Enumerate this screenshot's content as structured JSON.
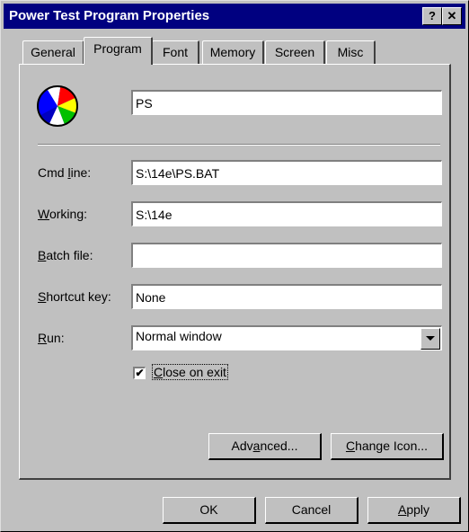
{
  "window": {
    "title": "Power Test Program Properties",
    "help_label": "?",
    "close_label": "✕"
  },
  "tabs": [
    {
      "label": "General"
    },
    {
      "label": "Program"
    },
    {
      "label": "Font"
    },
    {
      "label": "Memory"
    },
    {
      "label": "Screen"
    },
    {
      "label": "Misc"
    }
  ],
  "program": {
    "icon": "beach-ball-icon",
    "name_value": "PS",
    "cmdline": {
      "label_pre": "Cmd ",
      "label_key": "l",
      "label_post": "ine:",
      "value": "S:\\14e\\PS.BAT"
    },
    "working": {
      "label_pre": "",
      "label_key": "W",
      "label_post": "orking:",
      "value": "S:\\14e"
    },
    "batch": {
      "label_pre": "",
      "label_key": "B",
      "label_post": "atch file:",
      "value": ""
    },
    "shortcut": {
      "label_pre": "",
      "label_key": "S",
      "label_post": "hortcut key:",
      "value": "None"
    },
    "run": {
      "label_pre": "",
      "label_key": "R",
      "label_post": "un:",
      "value": "Normal window",
      "arrow_icon": "chevron-down-icon"
    },
    "close_on_exit": {
      "label_pre": "",
      "label_key": "C",
      "label_post": "lose on exit",
      "checked": true,
      "check_mark": "✔"
    },
    "advanced": {
      "pre": "Adv",
      "key": "a",
      "post": "nced..."
    },
    "change_icon": {
      "pre": "",
      "key": "C",
      "post": "hange Icon..."
    }
  },
  "footer": {
    "ok_label": "OK",
    "cancel_label": "Cancel",
    "apply": {
      "pre": "",
      "key": "A",
      "post": "pply"
    }
  }
}
